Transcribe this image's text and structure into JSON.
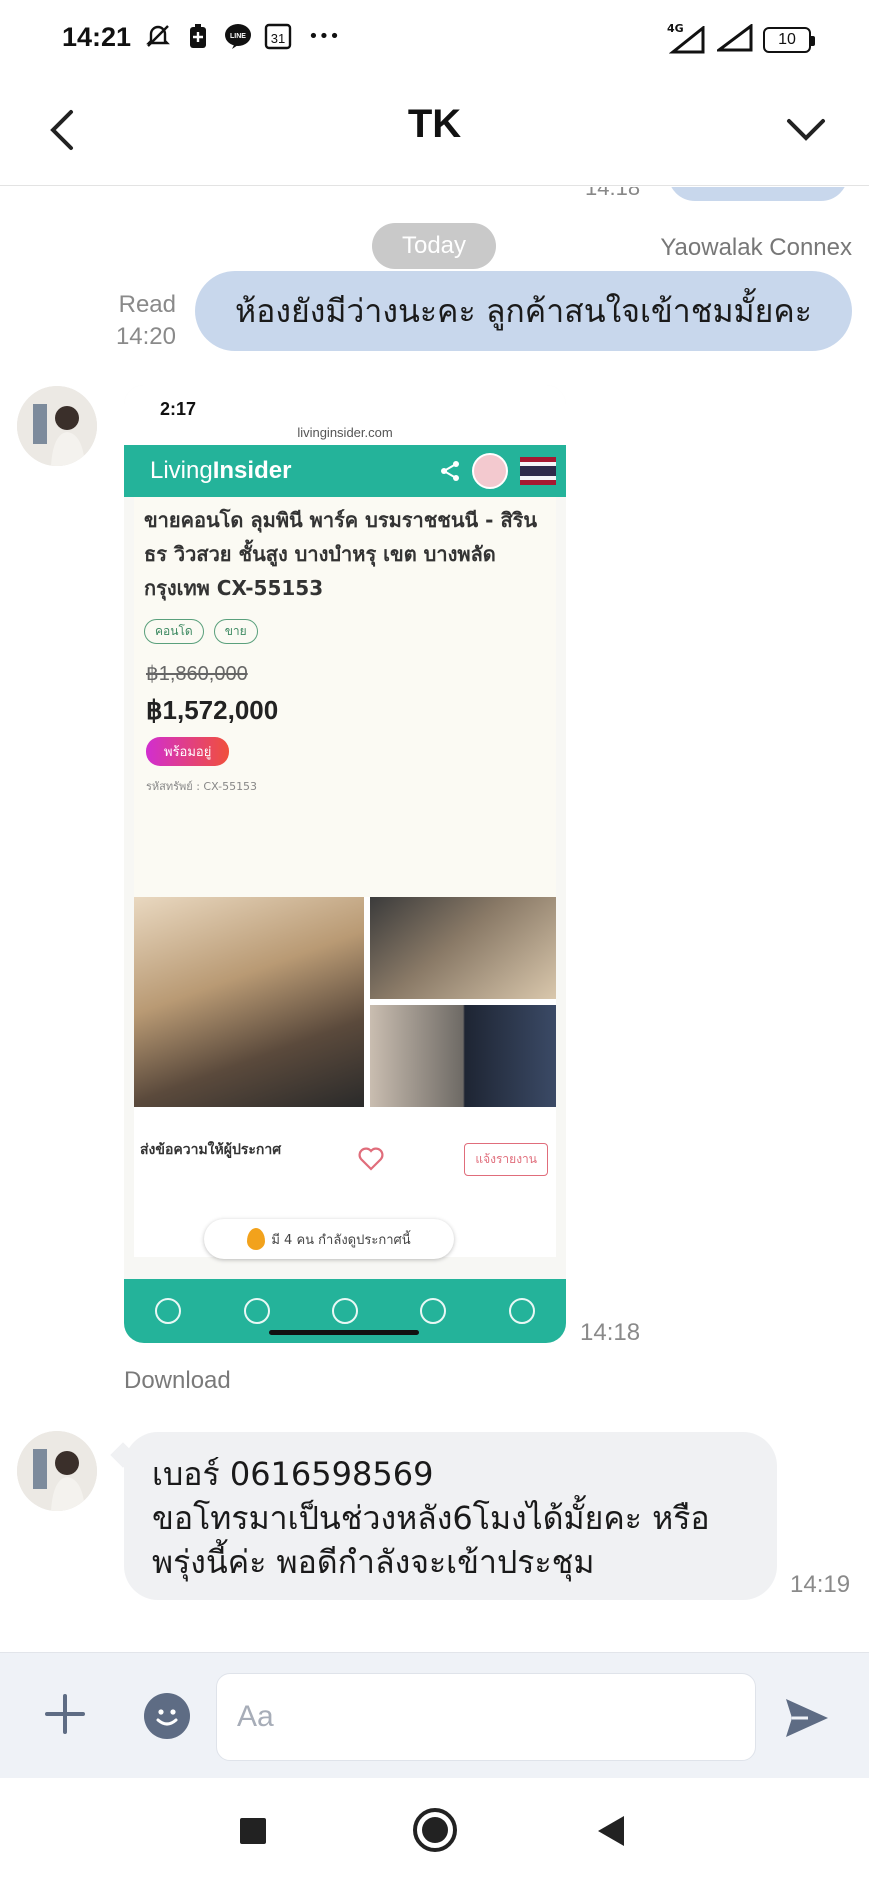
{
  "status_bar": {
    "time": "14:21",
    "notification_icons": [
      "mute-icon",
      "battery-saver-icon",
      "line-app-icon",
      "calendar-icon",
      "more-icon"
    ],
    "calendar_day": "31",
    "more": "•••",
    "network": "4G",
    "battery_level": "10"
  },
  "header": {
    "title": "TK"
  },
  "chat": {
    "prev_time": "14:18",
    "date_divider": "Today",
    "outgoing": {
      "sender": "Yaowalak Connex",
      "text": "ห้องยังมีว่างนะคะ ลูกค้าสนใจเข้าชมมั้ยคะ",
      "read_label": "Read",
      "time": "14:20"
    },
    "image_message": {
      "time": "14:18",
      "download_label": "Download",
      "screenshot": {
        "status_time": "2:17",
        "url": "livinginsider.com",
        "brand_a": "Living",
        "brand_b": "Insider",
        "title": "ขายคอนโด ลุมพินี พาร์ค บรมราชชนนี - สิรินธร วิวสวย ชั้นสูง บางบำหรุ เขต บางพลัด กรุงเทพ CX-55153",
        "tags": [
          "คอนโด",
          "ขาย"
        ],
        "old_price": "฿1,860,000",
        "price": "฿1,572,000",
        "badge": "พร้อมอยู่",
        "meta": "รหัสทรัพย์ : CX-55153",
        "cta_label": "ส่งข้อความให้ผู้ประกาศ",
        "ask_button": "แจ้งรายงาน",
        "toast": "มี 4 คน กำลังดูประกาศนี้"
      }
    },
    "incoming": {
      "lines": [
        "เบอร์ 0616598569",
        "ขอโทรมาเป็นช่วงหลัง6โมงได้มั้ยคะ หรือ",
        "พรุ่งนี้ค่ะ พอดีกำลังจะเข้าประชุม"
      ],
      "time": "14:19"
    }
  },
  "input_bar": {
    "placeholder": "Aa"
  },
  "colors": {
    "outgoing_bubble": "#c8d7ec",
    "incoming_bubble": "#f0f1f3",
    "input_bar_bg": "#eff2f7",
    "accent_icon": "#5e6c84",
    "living_insider_green": "#24b39a"
  }
}
